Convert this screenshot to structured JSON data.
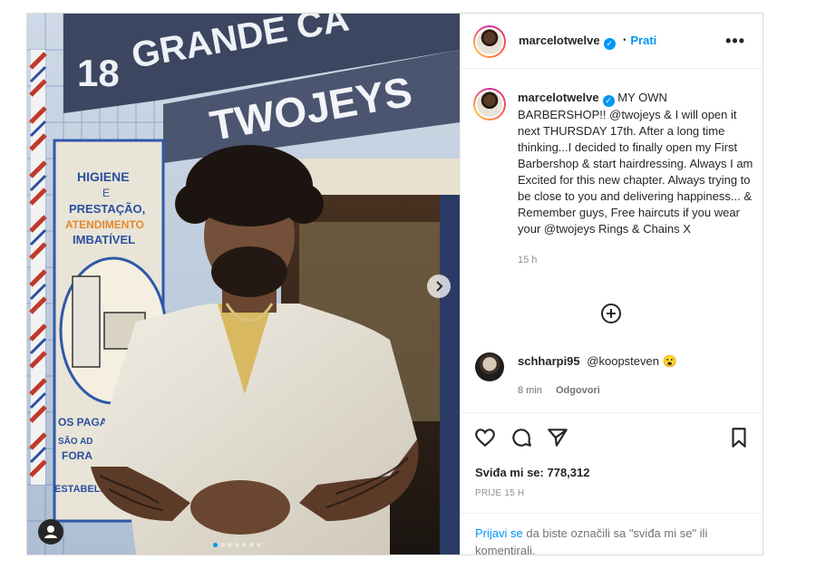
{
  "post": {
    "author": "marcelotwelve",
    "follow_label": "Prati",
    "dot_sep": "•",
    "more_label": "•••",
    "caption": "MY OWN BARBERSHOP!! @twojeys & I will open it next THURSDAY 17th. After a long time thinking...I decided to finally open my First Barbershop & start hairdressing. Always I am Excited for this new chapter. Always trying to be close to you and delivering happiness... & Remember guys, Free haircuts if you wear your @twojeys Rings & Chains X",
    "caption_time": "15 h"
  },
  "media": {
    "signs": {
      "top_left": "18",
      "top": "GRANDE CA",
      "shop": "TWOJEYS",
      "poster_line1": "HIGIENE",
      "poster_line2": "E",
      "poster_line3": "PRESTAÇÃO,",
      "poster_line4": "ATENDIMENTO",
      "poster_line5": "IMBATÍVEL",
      "bottom1": "OS PAGAM",
      "bottom2": "SÃO AD",
      "bottom3": "FORA",
      "bottom4": "ESTABELE"
    },
    "carousel": {
      "count": 7,
      "active_index": 0
    }
  },
  "comment": {
    "user": "schharpi95",
    "text": "@koopsteven 😮",
    "time": "8 min",
    "reply_label": "Odgovori"
  },
  "actions": {
    "likes_text": "Sviđa mi se: 778,312",
    "posted_ago": "PRIJE 15 H"
  },
  "login_prompt": {
    "link": "Prijavi se",
    "text": " da biste označili sa \"sviđa mi se\" ili komentirali."
  },
  "icons": [
    "more-icon",
    "verified-icon",
    "add-comment-icon",
    "heart-icon",
    "comment-icon",
    "share-icon",
    "bookmark-icon",
    "next-icon",
    "user-tag-icon"
  ],
  "colors": {
    "accent": "#0095f6",
    "text": "#262626",
    "muted": "#8e8e8e"
  }
}
